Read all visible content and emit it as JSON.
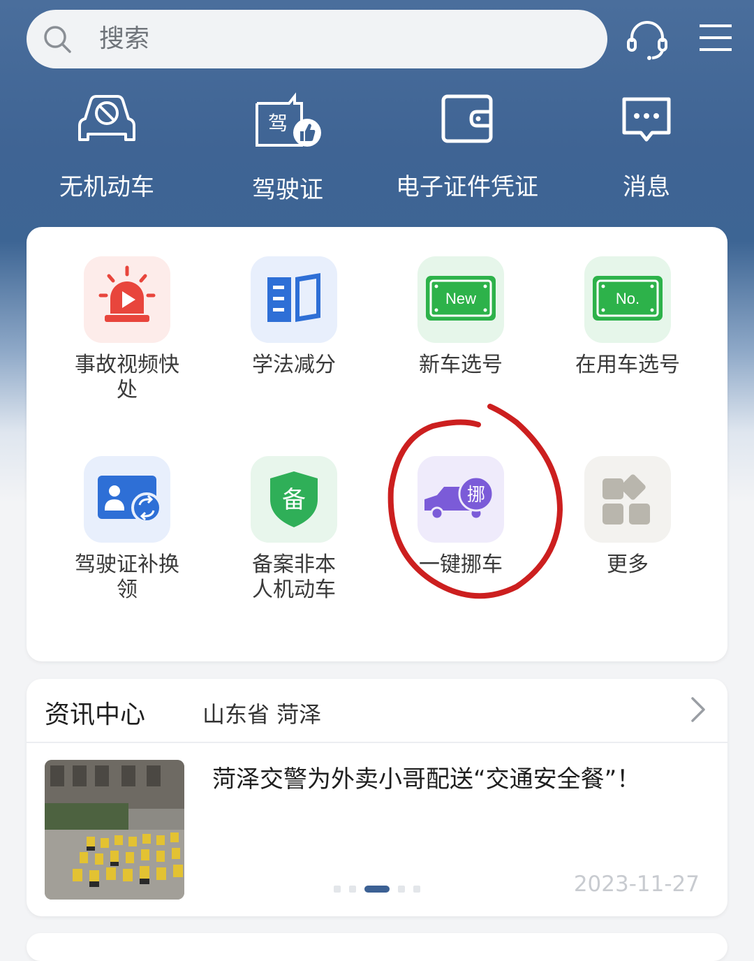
{
  "search": {
    "placeholder": "搜索"
  },
  "quick_actions": [
    {
      "label": "无机动车",
      "icon": "no-vehicle-icon"
    },
    {
      "label": "驾驶证",
      "icon": "driver-license-icon",
      "badge": "驾"
    },
    {
      "label": "电子证件凭证",
      "icon": "e-wallet-icon"
    },
    {
      "label": "消息",
      "icon": "message-icon"
    }
  ],
  "services": [
    {
      "label": "事故视频快处",
      "icon": "accident-alarm-icon",
      "color": "#e8453c"
    },
    {
      "label": "学法减分",
      "icon": "study-book-icon",
      "color": "#2e6fd6"
    },
    {
      "label": "新车选号",
      "icon": "new-plate-icon",
      "plate_text": "New",
      "color": "#2db24a"
    },
    {
      "label": "在用车选号",
      "icon": "used-plate-icon",
      "plate_text": "No.",
      "color": "#2db24a"
    },
    {
      "label": "驾驶证补换领",
      "icon": "license-reissue-icon",
      "color": "#2e6fd6"
    },
    {
      "label": "备案非本人机动车",
      "icon": "record-shield-icon",
      "shield_text": "备",
      "color": "#2faf58"
    },
    {
      "label": "一键挪车",
      "icon": "move-car-icon",
      "badge_text": "挪",
      "color": "#7b5bd8"
    },
    {
      "label": "更多",
      "icon": "more-grid-icon",
      "color": "#b9b6ad"
    }
  ],
  "news": {
    "title": "资讯中心",
    "region": "山东省 菏泽",
    "headline": "菏泽交警为外卖小哥配送“交通安全餐”！",
    "date": "2023-11-27",
    "carousel_count": 5,
    "carousel_active": 3
  },
  "annotation": {
    "color": "#cc1f1f"
  },
  "colors": {
    "header_bg": "#3f6494",
    "accent": "#3c6194"
  }
}
